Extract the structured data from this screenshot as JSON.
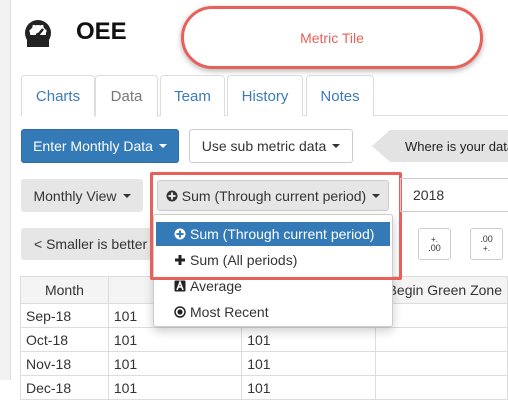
{
  "app": {
    "title": "OEE",
    "callout_text": "Metric Tile"
  },
  "tabs": [
    {
      "label": "Charts"
    },
    {
      "label": "Data"
    },
    {
      "label": "Team"
    },
    {
      "label": "History"
    },
    {
      "label": "Notes"
    }
  ],
  "toolbar": {
    "enter_data_label": "Enter Monthly Data",
    "sub_metric_label": "Use sub metric data",
    "where_label": "Where is your data"
  },
  "controls": {
    "view_label": "Monthly View",
    "aggregation_selected": "Sum (Through current period)",
    "year_value": "2018",
    "smaller_better_label": "< Smaller is better",
    "decimal_inc_label": ".00",
    "decimal_dec_label": ".00"
  },
  "dropdown": {
    "options": [
      {
        "label": "Sum (Through current period)",
        "icon": "plus-circle-icon",
        "selected": true
      },
      {
        "label": "Sum (All periods)",
        "icon": "plus-icon",
        "selected": false
      },
      {
        "label": "Average",
        "icon": "average-icon",
        "selected": false
      },
      {
        "label": "Most Recent",
        "icon": "record-icon",
        "selected": false
      }
    ]
  },
  "table": {
    "headers": [
      "Month",
      "",
      "",
      "Begin Green Zone"
    ],
    "rows": [
      {
        "month": "Sep-18",
        "c1": "101",
        "c2": "101",
        "c3": ""
      },
      {
        "month": "Oct-18",
        "c1": "101",
        "c2": "101",
        "c3": ""
      },
      {
        "month": "Nov-18",
        "c1": "101",
        "c2": "101",
        "c3": ""
      },
      {
        "month": "Dec-18",
        "c1": "101",
        "c2": "101",
        "c3": ""
      }
    ]
  },
  "colors": {
    "primary": "#337ab7",
    "highlight": "#e8605a"
  }
}
